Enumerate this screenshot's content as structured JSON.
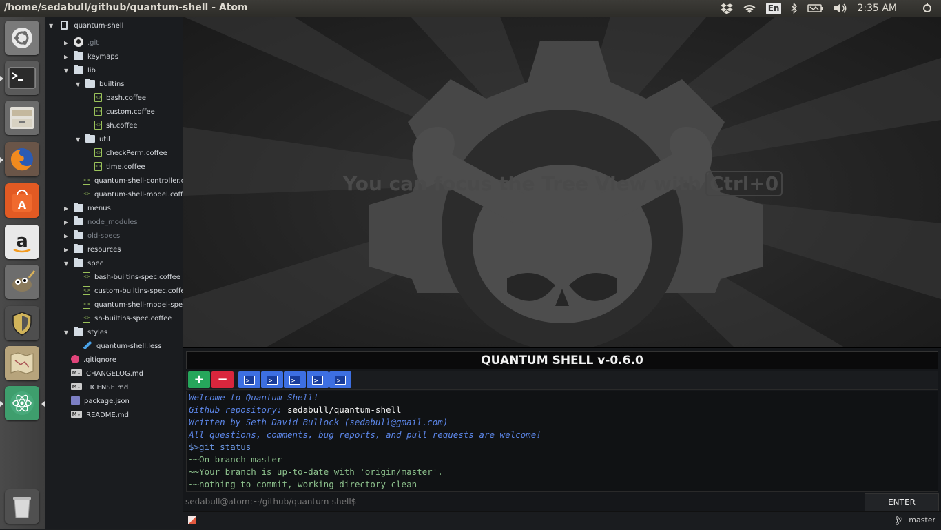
{
  "window": {
    "title": "/home/sedabull/github/quantum-shell - Atom"
  },
  "tray": {
    "language": "En",
    "clock": "2:35 AM"
  },
  "launcher": {
    "items": [
      {
        "name": "ubuntu-dash"
      },
      {
        "name": "terminal"
      },
      {
        "name": "files"
      },
      {
        "name": "firefox"
      },
      {
        "name": "software-center"
      },
      {
        "name": "amazon"
      },
      {
        "name": "gimp"
      },
      {
        "name": "security"
      },
      {
        "name": "maps"
      },
      {
        "name": "atom"
      },
      {
        "name": "trash"
      }
    ]
  },
  "tree": {
    "root": "quantum-shell",
    "items": [
      {
        "label": ".git",
        "type": "git",
        "indent": 1,
        "arrow": "right",
        "dim": true
      },
      {
        "label": "keymaps",
        "type": "folder",
        "indent": 1,
        "arrow": "right"
      },
      {
        "label": "lib",
        "type": "folder",
        "indent": 1,
        "arrow": "down"
      },
      {
        "label": "builtins",
        "type": "folder",
        "indent": 2,
        "arrow": "down"
      },
      {
        "label": "bash.coffee",
        "type": "file",
        "indent": 3
      },
      {
        "label": "custom.coffee",
        "type": "file",
        "indent": 3
      },
      {
        "label": "sh.coffee",
        "type": "file",
        "indent": 3
      },
      {
        "label": "util",
        "type": "folder",
        "indent": 2,
        "arrow": "down"
      },
      {
        "label": "checkPerm.coffee",
        "type": "file",
        "indent": 3
      },
      {
        "label": "time.coffee",
        "type": "file",
        "indent": 3
      },
      {
        "label": "quantum-shell-controller.coffee",
        "type": "file",
        "indent": 2
      },
      {
        "label": "quantum-shell-model.coffee",
        "type": "file",
        "indent": 2
      },
      {
        "label": "menus",
        "type": "folder",
        "indent": 1,
        "arrow": "right"
      },
      {
        "label": "node_modules",
        "type": "folder",
        "indent": 1,
        "arrow": "right",
        "dim": true
      },
      {
        "label": "old-specs",
        "type": "folder",
        "indent": 1,
        "arrow": "right",
        "dim": true
      },
      {
        "label": "resources",
        "type": "folder",
        "indent": 1,
        "arrow": "right"
      },
      {
        "label": "spec",
        "type": "folder",
        "indent": 1,
        "arrow": "down"
      },
      {
        "label": "bash-builtins-spec.coffee",
        "type": "file",
        "indent": 2
      },
      {
        "label": "custom-builtins-spec.coffee",
        "type": "file",
        "indent": 2
      },
      {
        "label": "quantum-shell-model-spec.coffee",
        "type": "file",
        "indent": 2
      },
      {
        "label": "sh-builtins-spec.coffee",
        "type": "file",
        "indent": 2
      },
      {
        "label": "styles",
        "type": "folder",
        "indent": 1,
        "arrow": "down"
      },
      {
        "label": "quantum-shell.less",
        "type": "less",
        "indent": 2
      },
      {
        "label": ".gitignore",
        "type": "gitignore",
        "indent": 1
      },
      {
        "label": "CHANGELOG.md",
        "type": "md",
        "indent": 1
      },
      {
        "label": "LICENSE.md",
        "type": "md",
        "indent": 1
      },
      {
        "label": "package.json",
        "type": "pkg",
        "indent": 1
      },
      {
        "label": "README.md",
        "type": "md",
        "indent": 1
      }
    ]
  },
  "editor": {
    "hint": "You can focus the Tree View with",
    "hint_key": "Ctrl+0"
  },
  "quantum_shell": {
    "title": "QUANTUM SHELL v-0.6.0",
    "add_label": "+",
    "remove_label": "−",
    "terminals": 5,
    "output": [
      {
        "text": "Welcome to Quantum Shell!",
        "style": "italic"
      },
      {
        "prefix": "Github repository: ",
        "text": "sedabull/quantum-shell",
        "style": "mixed"
      },
      {
        "text": "Written by Seth David Bullock (sedabull@gmail.com)",
        "style": "italic"
      },
      {
        "text": "All questions, comments, bug reports, and pull requests are welcome!",
        "style": "italic"
      },
      {
        "text": "$>git status",
        "style": "cmd"
      },
      {
        "text": "~~On branch master",
        "style": "res"
      },
      {
        "text": "~~Your branch is up-to-date with 'origin/master'.",
        "style": "res"
      },
      {
        "text": "~~nothing to commit, working directory clean",
        "style": "res"
      }
    ],
    "prompt": "sedabull@atom:~/github/quantum-shell$",
    "enter_label": "ENTER"
  },
  "status_bar": {
    "branch": "master"
  },
  "colors": {
    "accent": "#3d6fe2",
    "add": "#26a65b",
    "remove": "#d9263d",
    "coffee": "#9ac25a"
  }
}
